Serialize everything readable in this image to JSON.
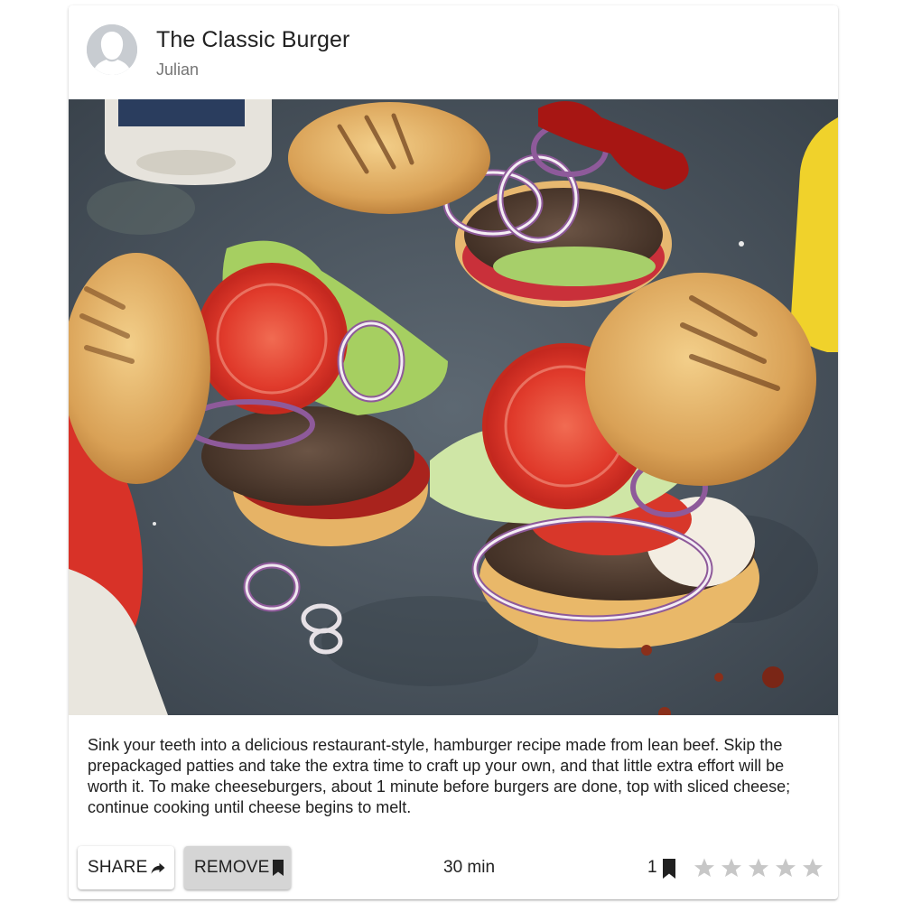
{
  "card": {
    "title": "The Classic Burger",
    "author": "Julian",
    "description": "Sink your teeth into a delicious restaurant-style, hamburger recipe made from lean beef. Skip the prepackaged patties and take the extra time to craft up your own, and that little extra effort will be worth it. To make cheeseburgers, about 1 minute before burgers are done, top with sliced cheese; continue cooking until cheese begins to melt.",
    "image_alt": "Burgers with tomato, lettuce and red onion on a dark slate surface"
  },
  "actions": {
    "share_label": "SHARE",
    "share_icon": "share-arrow-icon",
    "remove_label": "REMOVE",
    "remove_icon": "bookmark-icon",
    "time": "30 min",
    "bookmark_count": "1",
    "rating": 0,
    "rating_max": 5
  },
  "colors": {
    "remove_bg": "#d5d5d5",
    "star_empty": "#c7c7c7",
    "avatar_bg": "#c8ccd1",
    "subheader": "#757575"
  }
}
